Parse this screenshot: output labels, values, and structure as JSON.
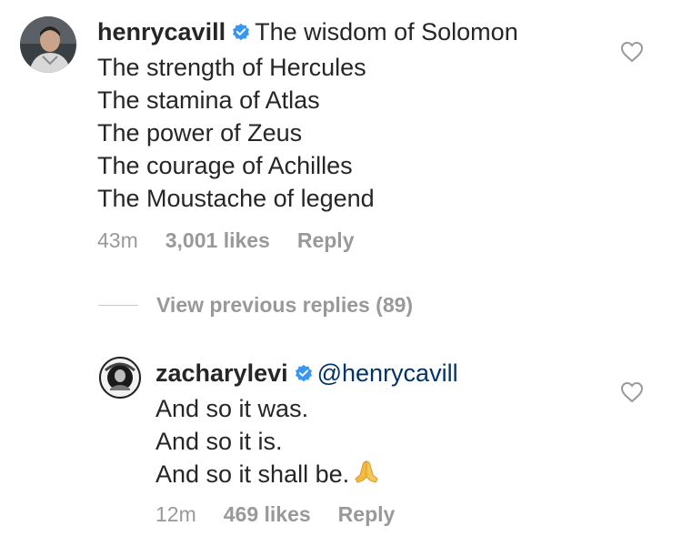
{
  "comment1": {
    "username": "henrycavill",
    "lines": [
      "The wisdom of Solomon",
      "The strength of Hercules",
      "The stamina of Atlas",
      "The power of Zeus",
      "The courage of Achilles",
      "The Moustache of legend"
    ],
    "time": "43m",
    "likes": "3,001 likes",
    "reply_label": "Reply"
  },
  "view_previous": "View previous replies (89)",
  "comment2": {
    "username": "zacharylevi",
    "mention": "@henrycavill",
    "lines": [
      "And so it was.",
      "And so it is.",
      "And so it shall be."
    ],
    "emoji": "folded-hands-emoji",
    "time": "12m",
    "likes": "469 likes",
    "reply_label": "Reply"
  },
  "colors": {
    "text": "#262626",
    "meta": "#999999",
    "verified": "#3897f0",
    "mention": "#003569"
  }
}
